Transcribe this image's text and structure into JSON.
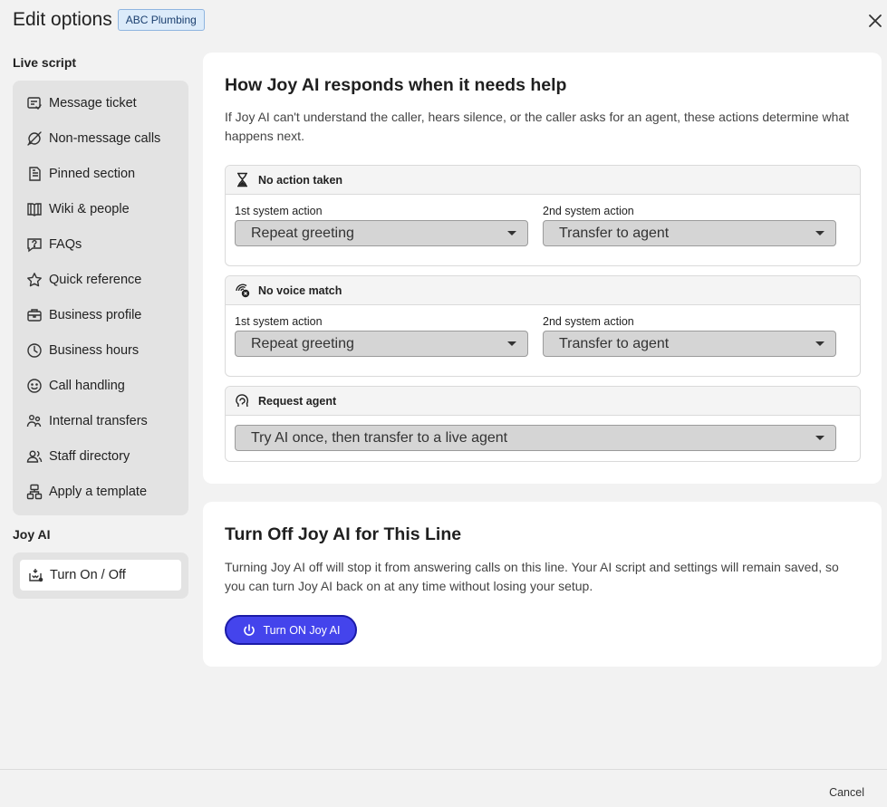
{
  "header": {
    "title": "Edit options",
    "badge": "ABC Plumbing",
    "close_icon": "close-icon"
  },
  "sidebar": {
    "live_script_title": "Live script",
    "items": [
      {
        "label": "Message ticket",
        "icon": "message-ticket-icon"
      },
      {
        "label": "Non-message calls",
        "icon": "non-message-icon"
      },
      {
        "label": "Pinned section",
        "icon": "pinned-icon"
      },
      {
        "label": "Wiki & people",
        "icon": "book-icon"
      },
      {
        "label": "FAQs",
        "icon": "faq-icon"
      },
      {
        "label": "Quick reference",
        "icon": "star-icon"
      },
      {
        "label": "Business profile",
        "icon": "briefcase-icon"
      },
      {
        "label": "Business hours",
        "icon": "clock-icon"
      },
      {
        "label": "Call handling",
        "icon": "smiley-icon"
      },
      {
        "label": "Internal transfers",
        "icon": "transfer-people-icon"
      },
      {
        "label": "Staff directory",
        "icon": "people-icon"
      },
      {
        "label": "Apply a template",
        "icon": "template-icon"
      }
    ],
    "joy_ai_title": "Joy AI",
    "joy_items": [
      {
        "label": "Turn On / Off",
        "icon": "robot-icon"
      }
    ]
  },
  "help_card": {
    "title": "How Joy AI responds when it needs help",
    "description": "If Joy AI can't understand the caller, hears silence, or the caller asks for an agent, these actions determine what happens next.",
    "groups": [
      {
        "title": "No action taken",
        "icon": "hourglass-icon",
        "label1": "1st system action",
        "value1": "Repeat greeting",
        "label2": "2nd system action",
        "value2": "Transfer to agent"
      },
      {
        "title": "No voice match",
        "icon": "voice-off-icon",
        "label1": "1st system action",
        "value1": "Repeat greeting",
        "label2": "2nd system action",
        "value2": "Transfer to agent"
      },
      {
        "title": "Request agent",
        "icon": "agent-head-icon",
        "value": "Try AI once, then transfer to a live agent"
      }
    ]
  },
  "turn_off_card": {
    "title": "Turn Off Joy AI for This Line",
    "description": "Turning Joy AI off will stop it from answering calls on this line. Your AI script and settings will remain saved, so you can turn Joy AI back on at any time without losing your setup.",
    "button_label": "Turn ON Joy AI",
    "button_icon": "power-icon",
    "button_color": "#4444ec"
  },
  "footer": {
    "cancel_label": "Cancel"
  }
}
